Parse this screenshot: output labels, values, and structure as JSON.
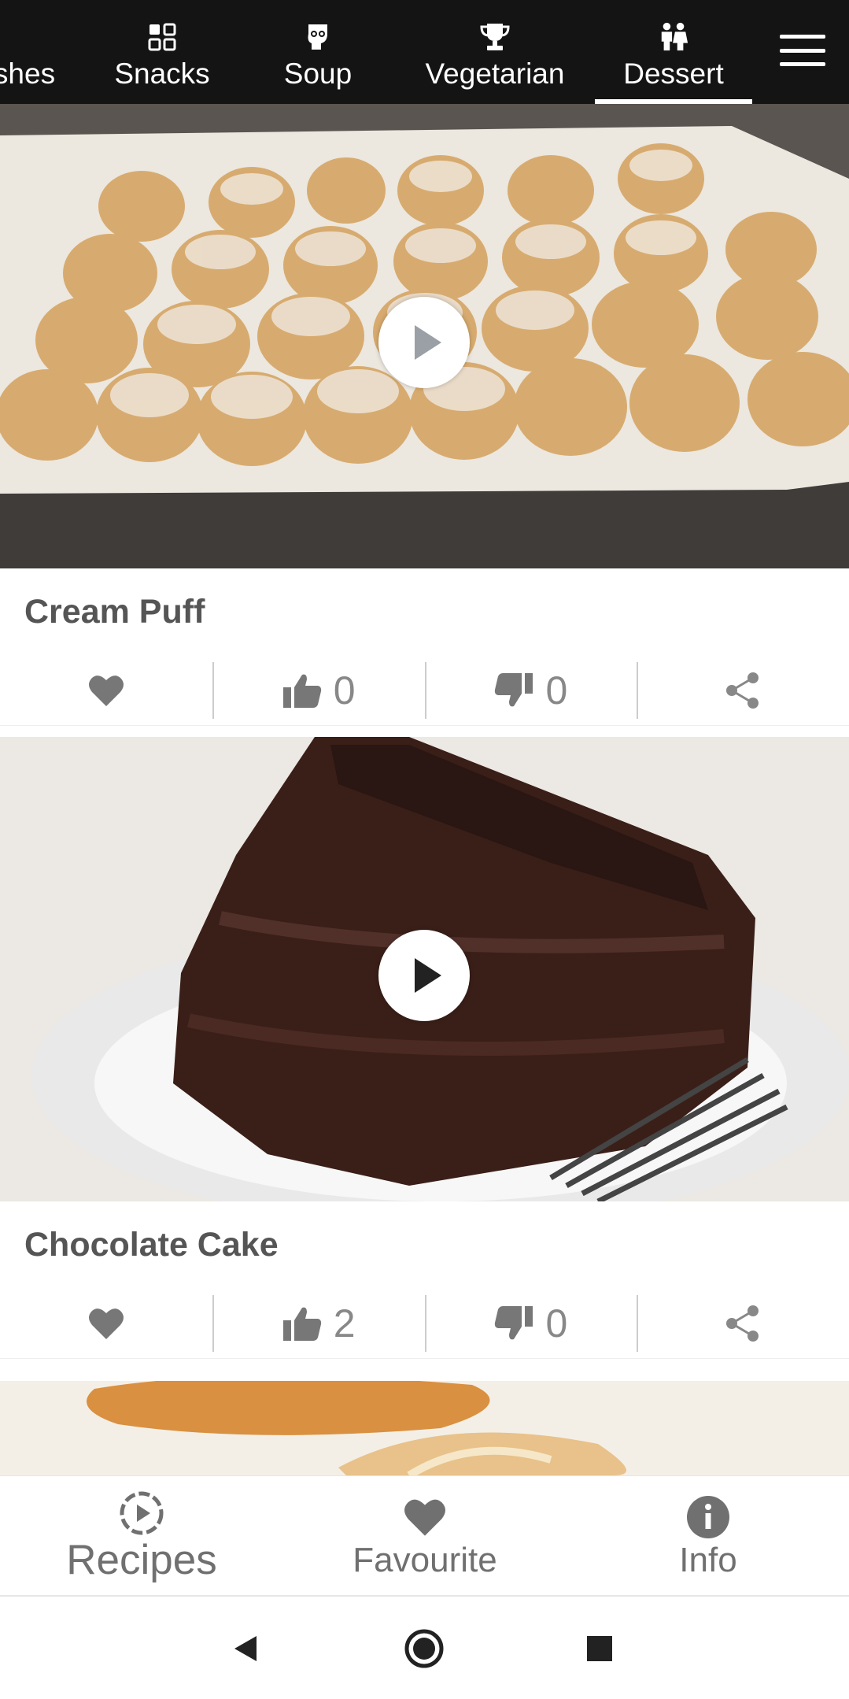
{
  "top_tabs": [
    {
      "label": "shes",
      "icon": "dishes-icon"
    },
    {
      "label": "Snacks",
      "icon": "snacks-icon"
    },
    {
      "label": "Soup",
      "icon": "soup-icon"
    },
    {
      "label": "Vegetarian",
      "icon": "trophy-icon"
    },
    {
      "label": "Dessert",
      "icon": "dessert-icon",
      "active": true
    }
  ],
  "menu_icon": "hamburger-menu-icon",
  "recipes": [
    {
      "title": "Cream Puff",
      "likes": "0",
      "dislikes": "0"
    },
    {
      "title": "Chocolate Cake",
      "likes": "2",
      "dislikes": "0"
    },
    {
      "title": ""
    }
  ],
  "bottom_nav": [
    {
      "label": "Recipes",
      "icon": "play-circle-icon",
      "active": true
    },
    {
      "label": "Favourite",
      "icon": "heart-icon"
    },
    {
      "label": "Info",
      "icon": "info-icon"
    }
  ],
  "system_nav": [
    "back-icon",
    "home-icon",
    "recents-icon"
  ],
  "colors": {
    "topbar_bg": "#141414",
    "action_icon": "#777777",
    "title_text": "#555555",
    "nav_text": "#707070"
  }
}
